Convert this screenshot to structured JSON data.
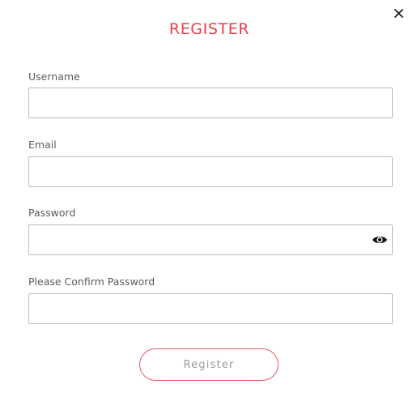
{
  "modal": {
    "title": "REGISTER",
    "close_icon": "close-icon"
  },
  "fields": [
    {
      "label": "Username",
      "value": "",
      "placeholder": ""
    },
    {
      "label": "Email",
      "value": "",
      "placeholder": ""
    },
    {
      "label": "Password",
      "value": "",
      "placeholder": "",
      "icon": "eye-icon"
    },
    {
      "label": "Please Confirm Password",
      "value": "",
      "placeholder": ""
    }
  ],
  "submit": {
    "label": "Register"
  },
  "colors": {
    "accent": "#e8404a",
    "button_border": "#e05a66",
    "label_text": "#5c5c5c",
    "button_text": "#9c9c9c",
    "input_border": "#bdbdbd"
  }
}
